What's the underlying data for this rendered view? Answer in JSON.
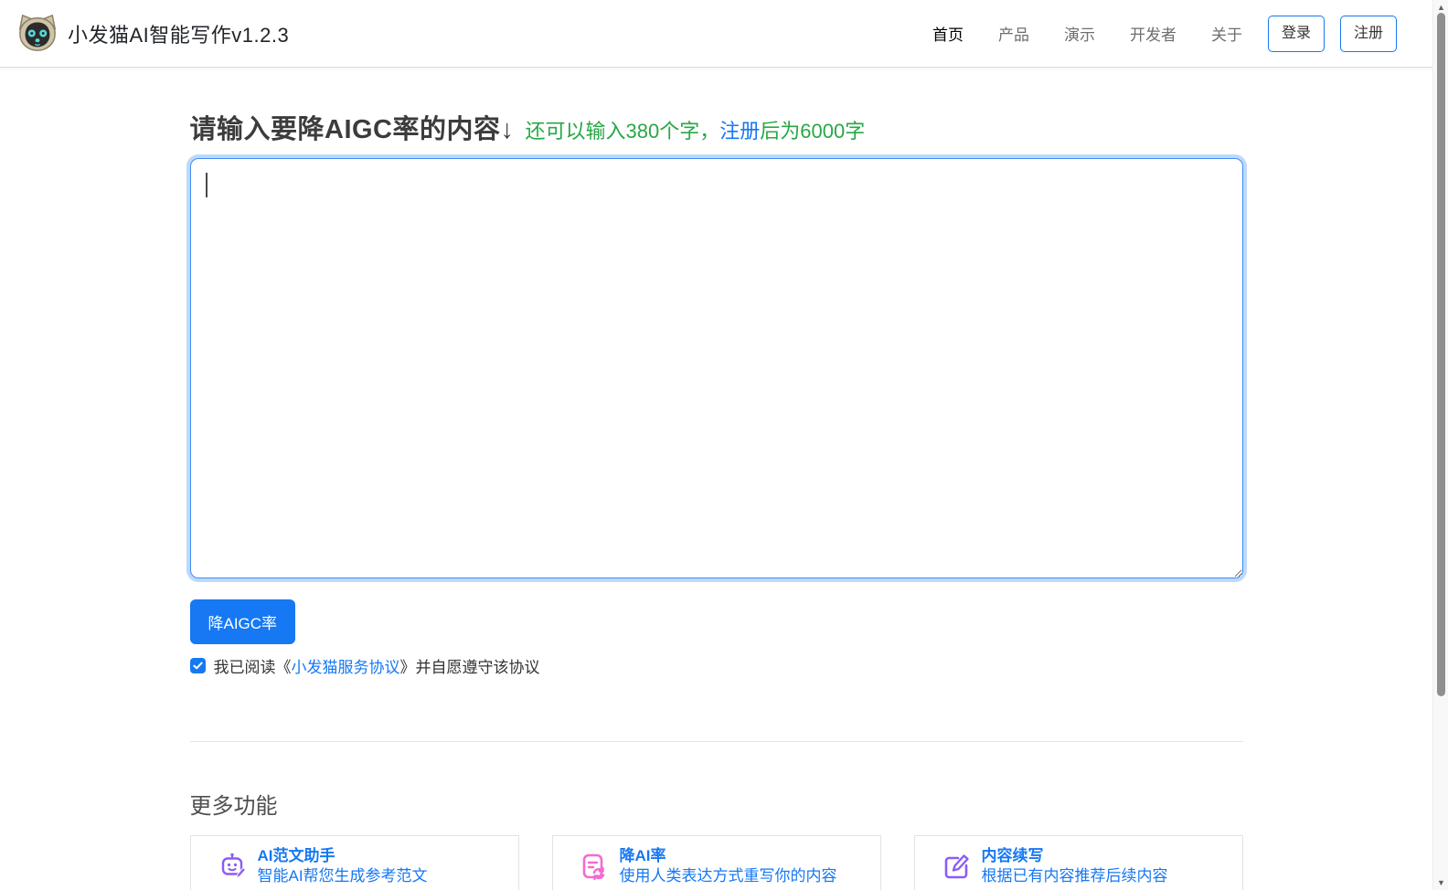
{
  "navbar": {
    "brand": "小发猫AI智能写作v1.2.3",
    "links": [
      {
        "label": "首页",
        "active": true
      },
      {
        "label": "产品",
        "active": false
      },
      {
        "label": "演示",
        "active": false
      },
      {
        "label": "开发者",
        "active": false
      },
      {
        "label": "关于",
        "active": false
      }
    ],
    "login_label": "登录",
    "register_label": "注册"
  },
  "editor": {
    "heading": "请输入要降AIGC率的内容↓",
    "hint_part1": "还可以输入380个字，",
    "hint_link": "注册",
    "hint_part2": "后为6000字",
    "remaining_chars": "380",
    "registered_limit": "6000",
    "textarea_value": "",
    "textarea_placeholder": "",
    "submit_label": "降AIGC率",
    "agreement": {
      "checked": true,
      "prefix": "我已阅读《",
      "link": "小发猫服务协议",
      "suffix": "》并自愿遵守该协议"
    }
  },
  "more": {
    "title": "更多功能",
    "cards": [
      {
        "icon": "robot-pencil-icon",
        "title": "AI范文助手",
        "desc": "智能AI帮您生成参考范文"
      },
      {
        "icon": "document-refresh-icon",
        "title": "降AI率",
        "desc": "使用人类表达方式重写你的内容"
      },
      {
        "icon": "edit-square-icon",
        "title": "内容续写",
        "desc": "根据已有内容推荐后续内容"
      }
    ]
  },
  "colors": {
    "accent_blue": "#1678f3",
    "success_green": "#28a745",
    "icon_purple": "#8b5cf6",
    "icon_pink": "#f46ad3",
    "logo_tan": "#cfc3a8",
    "logo_dark": "#2b2b2b",
    "logo_eye_cyan": "#5cd6d6"
  }
}
